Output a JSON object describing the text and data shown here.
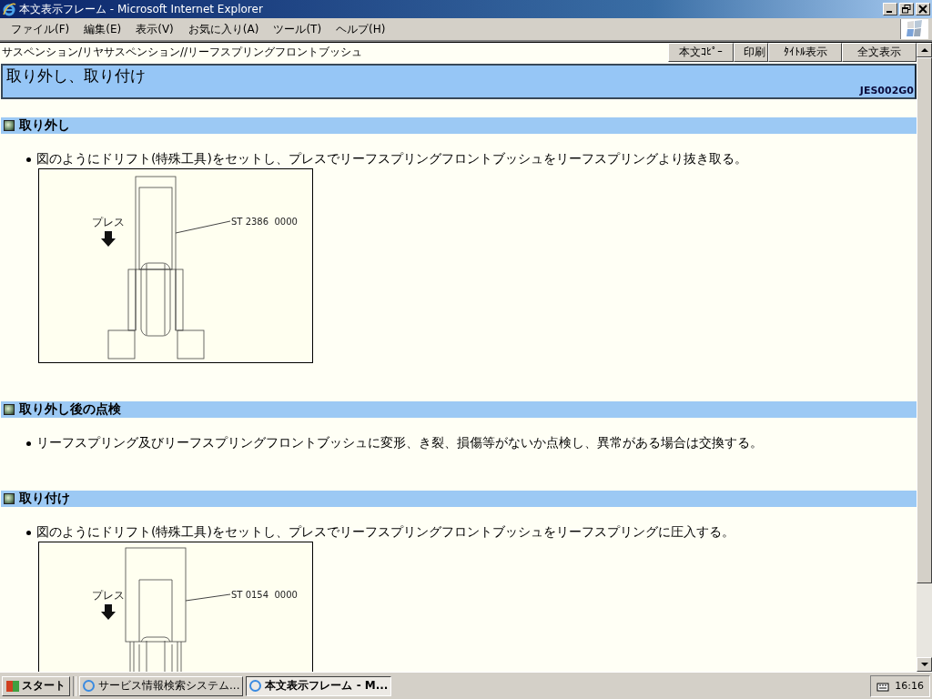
{
  "window": {
    "title": "本文表示フレーム - Microsoft Internet Explorer"
  },
  "menu": [
    "ファイル(F)",
    "編集(E)",
    "表示(V)",
    "お気に入り(A)",
    "ツール(T)",
    "ヘルプ(H)"
  ],
  "toolbar": {
    "breadcrumb": "サスペンション/リヤサスペンション//リーフスプリングフロントブッシュ",
    "buttons": [
      "本文ｺﾋﾟｰ",
      "印刷",
      "ﾀｲﾄﾙ表示",
      "全文表示"
    ]
  },
  "page": {
    "title": "取り外し、取り付け",
    "code": "JES002G0"
  },
  "sections": [
    {
      "heading": "取り外し",
      "bullets": [
        "図のようにドリフト(特殊工具)をセットし、プレスでリーフスプリングフロントブッシュをリーフスプリングより抜き取る。"
      ],
      "figure": {
        "kind": "removal",
        "press_label": "プレス",
        "part_number": "ST 2386  0000"
      }
    },
    {
      "heading": "取り外し後の点検",
      "bullets": [
        "リーフスプリング及びリーフスプリングフロントブッシュに変形、き裂、損傷等がないか点検し、異常がある場合は交換する。"
      ]
    },
    {
      "heading": "取り付け",
      "bullets": [
        "図のようにドリフト(特殊工具)をセットし、プレスでリーフスプリングフロントブッシュをリーフスプリングに圧入する。"
      ],
      "figure": {
        "kind": "installation",
        "press_label": "プレス",
        "part_number": "ST 0154  0000"
      }
    }
  ],
  "taskbar": {
    "start": "スタート",
    "tasks": [
      {
        "label": "サービス情報検索システム...",
        "selected": false
      },
      {
        "label": "本文表示フレーム - M...",
        "selected": true
      }
    ],
    "clock": "16:16"
  }
}
